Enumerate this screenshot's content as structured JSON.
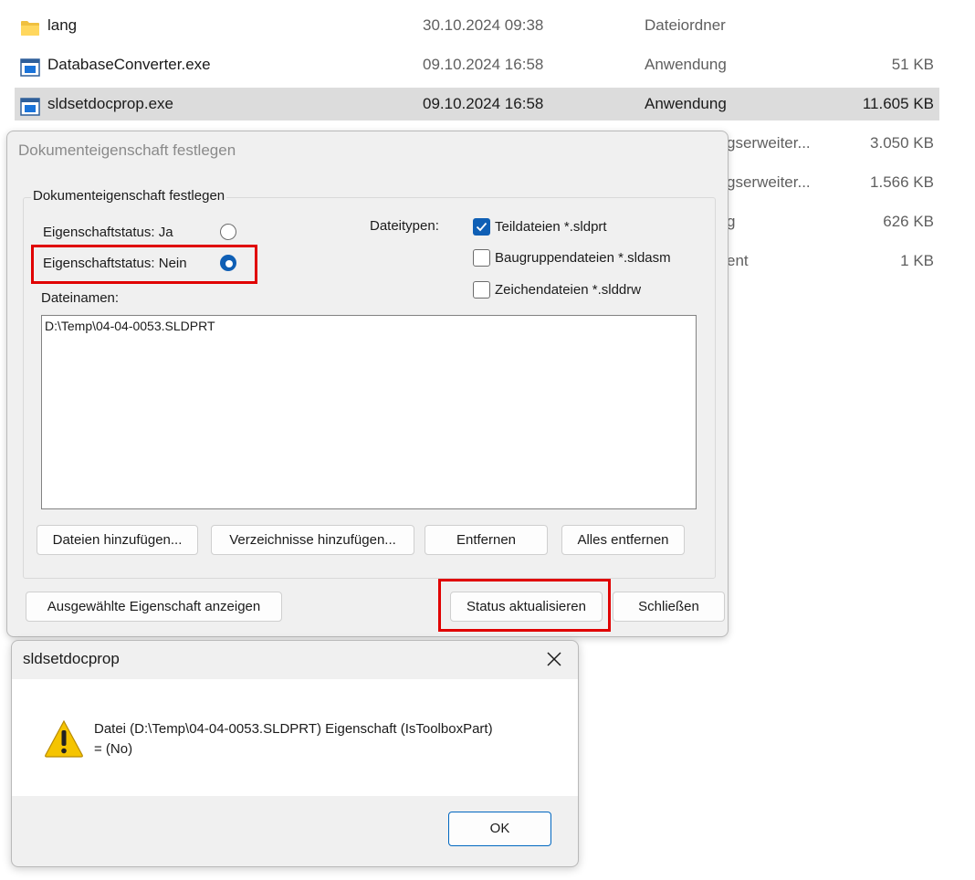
{
  "explorer": {
    "files": [
      {
        "name": "lang",
        "date": "30.10.2024 09:38",
        "type": "Dateiordner",
        "size": "",
        "icon": "folder-icon",
        "selected": false
      },
      {
        "name": "DatabaseConverter.exe",
        "date": "09.10.2024 16:58",
        "type": "Anwendung",
        "size": "51 KB",
        "icon": "application-icon",
        "selected": false
      },
      {
        "name": "sldsetdocprop.exe",
        "date": "09.10.2024 16:58",
        "type": "Anwendung",
        "size": "11.605 KB",
        "icon": "application-icon",
        "selected": true
      }
    ],
    "hidden_rows": [
      {
        "type_fragment": "gserweiter...",
        "size": "3.050 KB"
      },
      {
        "type_fragment": "gserweiter...",
        "size": "1.566 KB"
      },
      {
        "type_fragment": "g",
        "size": "626 KB"
      },
      {
        "type_fragment": "ent",
        "size": "1 KB"
      }
    ]
  },
  "dialog": {
    "title": "Dokumenteigenschaft festlegen",
    "group_label": "Dokumenteigenschaft festlegen",
    "radio_yes_label": "Eigenschaftstatus: Ja",
    "radio_no_label": "Eigenschaftstatus: Nein",
    "selected_status": "Nein",
    "file_types_label": "Dateitypen:",
    "checkboxes": [
      {
        "label": "Teildateien *.sldprt",
        "checked": true
      },
      {
        "label": "Baugruppendateien *.sldasm",
        "checked": false
      },
      {
        "label": "Zeichendateien *.slddrw",
        "checked": false
      }
    ],
    "filenames_label": "Dateinamen:",
    "filenames": [
      "D:\\Temp\\04-04-0053.SLDPRT"
    ],
    "buttons": {
      "add_files": "Dateien hinzufügen...",
      "add_dirs": "Verzeichnisse hinzufügen...",
      "remove": "Entfernen",
      "remove_all": "Alles entfernen",
      "show_property": "Ausgewählte Eigenschaft anzeigen",
      "update_status": "Status aktualisieren",
      "close": "Schließen"
    }
  },
  "messagebox": {
    "title": "sldsetdocprop",
    "line1": "Datei (D:\\Temp\\04-04-0053.SLDPRT) Eigenschaft (IsToolboxPart)",
    "line2": "= (No)",
    "ok": "OK",
    "icon": "warning-icon"
  },
  "colors": {
    "highlight": "#e00000",
    "accent": "#0f5fb5",
    "selection": "#dcdcdc"
  }
}
